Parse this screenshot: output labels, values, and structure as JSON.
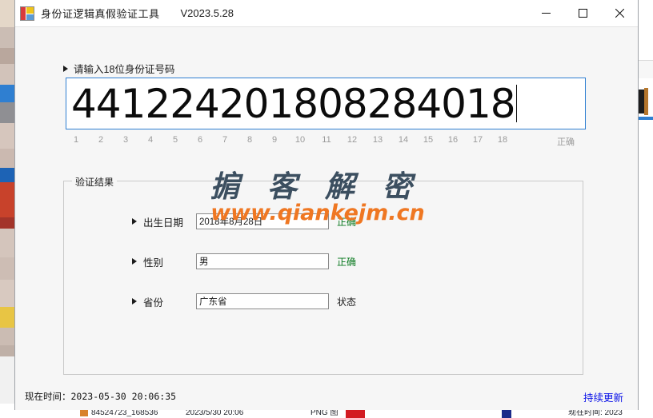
{
  "window": {
    "title": "身份证逻辑真假验证工具",
    "version": "V2023.5.28",
    "icon": "form-app-icon",
    "controls": {
      "minimize": "—",
      "maximize": "□",
      "close": "✕"
    }
  },
  "input_section": {
    "hint": "请输入18位身份证号码",
    "id_number": "441224201808284018",
    "placeholder": "",
    "ruler": [
      "1",
      "2",
      "3",
      "4",
      "5",
      "6",
      "7",
      "8",
      "9",
      "10",
      "11",
      "12",
      "13",
      "14",
      "15",
      "16",
      "17",
      "18"
    ],
    "checksum_status": "正确"
  },
  "result_group": {
    "legend": "验证结果",
    "fields": [
      {
        "label": "出生日期",
        "value": "2018年8月28日",
        "status": "正确",
        "status_kind": "ok"
      },
      {
        "label": "性别",
        "value": "男",
        "status": "正确",
        "status_kind": "ok"
      },
      {
        "label": "省份",
        "value": "广东省",
        "status": "状态",
        "status_kind": "neutral"
      }
    ]
  },
  "watermark": {
    "text": "掮 客 解 密",
    "url": "www.qiankejm.cn",
    "text_color": "#3c4f60",
    "url_color": "#ef7722"
  },
  "statusbar": {
    "time_label": "现在时间：2023-05-30 20:06:35",
    "update_link": "持续更新",
    "link_color": "#0a12e8"
  },
  "background": {
    "explorer_row": {
      "name": "84524723_168536",
      "date": "2023/5/30 20:06",
      "type": "PNG 图",
      "other_time": "现在时间: 2023"
    }
  },
  "colors": {
    "accent_border": "#2f7fd1",
    "status_ok": "#0a7a20",
    "link": "#0a12e8",
    "window_bg": "#f6f6f6"
  }
}
